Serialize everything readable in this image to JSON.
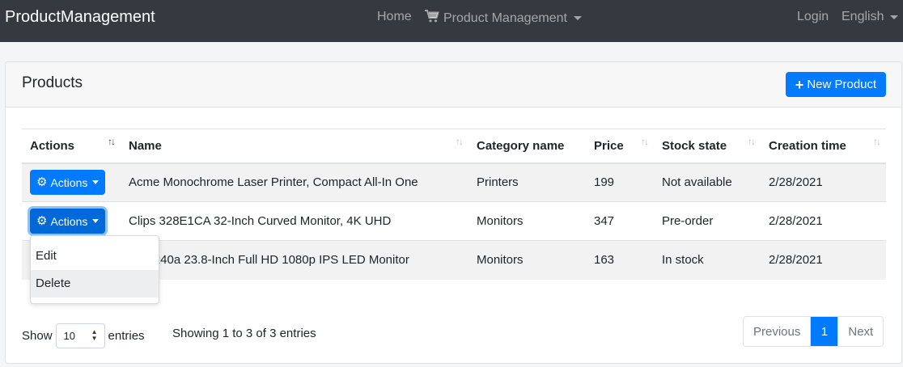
{
  "navbar": {
    "brand": "ProductManagement",
    "home": "Home",
    "product_management": "Product Management",
    "login": "Login",
    "language": "English"
  },
  "card": {
    "title": "Products",
    "new_product_label": "New Product"
  },
  "table": {
    "columns": [
      "Actions",
      "Name",
      "Category name",
      "Price",
      "Stock state",
      "Creation time"
    ],
    "action_label": "Actions",
    "rows": [
      {
        "name": "Acme Monochrome Laser Printer, Compact All-In One",
        "category": "Printers",
        "price": "199",
        "stock": "Not available",
        "created": "2/28/2021"
      },
      {
        "name": "Clips 328E1CA 32-Inch Curved Monitor, 4K UHD",
        "category": "Monitors",
        "price": "347",
        "stock": "Pre-order",
        "created": "2/28/2021"
      },
      {
        "name": "H240a 23.8-Inch Full HD 1080p IPS LED Monitor",
        "category": "Monitors",
        "price": "163",
        "stock": "In stock",
        "created": "2/28/2021"
      }
    ]
  },
  "dropdown": {
    "edit": "Edit",
    "delete": "Delete"
  },
  "footer": {
    "show": "Show",
    "page_size": "10",
    "entries": "entries",
    "info": "Showing 1 to 3 of 3 entries",
    "previous": "Previous",
    "current_page": "1",
    "next": "Next"
  },
  "colors": {
    "primary": "#007bff",
    "navbar": "#343a40"
  }
}
